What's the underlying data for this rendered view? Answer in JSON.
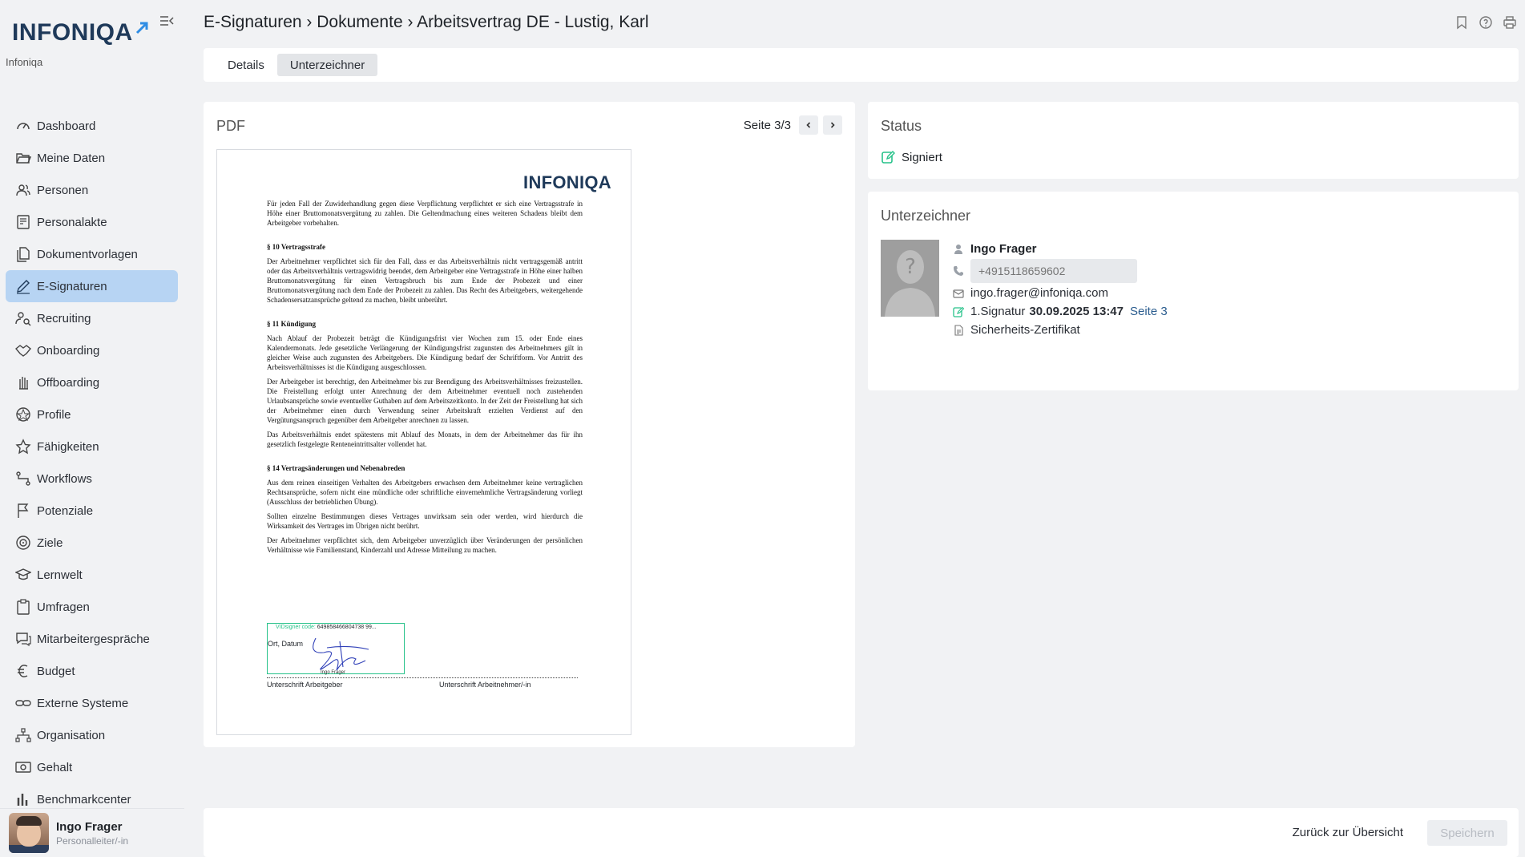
{
  "app": {
    "logo_text": "INFONIQA",
    "tenant": "Infoniqa"
  },
  "sidebar": {
    "items": [
      {
        "label": "Dashboard",
        "icon": "gauge-icon"
      },
      {
        "label": "Meine Daten",
        "icon": "folder-open-icon"
      },
      {
        "label": "Personen",
        "icon": "people-icon"
      },
      {
        "label": "Personalakte",
        "icon": "file-person-icon"
      },
      {
        "label": "Dokumentvorlagen",
        "icon": "documents-icon"
      },
      {
        "label": "E-Signaturen",
        "icon": "pen-icon",
        "active": true
      },
      {
        "label": "Recruiting",
        "icon": "person-search-icon"
      },
      {
        "label": "Onboarding",
        "icon": "handshake-icon"
      },
      {
        "label": "Offboarding",
        "icon": "hand-icon"
      },
      {
        "label": "Profile",
        "icon": "badge-icon"
      },
      {
        "label": "Fähigkeiten",
        "icon": "star-icon"
      },
      {
        "label": "Workflows",
        "icon": "workflow-icon"
      },
      {
        "label": "Potenziale",
        "icon": "flag-icon"
      },
      {
        "label": "Ziele",
        "icon": "target-icon"
      },
      {
        "label": "Lernwelt",
        "icon": "graduation-cap-icon"
      },
      {
        "label": "Umfragen",
        "icon": "clipboard-icon"
      },
      {
        "label": "Mitarbeitergespräche",
        "icon": "chat-icon"
      },
      {
        "label": "Budget",
        "icon": "euro-icon"
      },
      {
        "label": "Externe Systeme",
        "icon": "link-icon"
      },
      {
        "label": "Organisation",
        "icon": "org-chart-icon"
      },
      {
        "label": "Gehalt",
        "icon": "money-icon"
      },
      {
        "label": "Benchmarkcenter",
        "icon": "bar-chart-icon"
      }
    ],
    "user": {
      "name": "Ingo Frager",
      "role": "Personalleiter/-in"
    }
  },
  "header": {
    "breadcrumb": "E-Signaturen › Dokumente › Arbeitsvertrag DE - Lustig, Karl",
    "icons": [
      "bookmark-icon",
      "help-icon",
      "print-icon"
    ]
  },
  "tabs": [
    {
      "label": "Details",
      "active": false
    },
    {
      "label": "Unterzeichner",
      "active": true
    }
  ],
  "pdf": {
    "title": "PDF",
    "pager": "Seite 3/3",
    "page_logo": "INFONIQA",
    "intro": "Für jeden Fall der Zuwiderhandlung gegen diese Verpflichtung verpflichtet er sich eine Vertragsstrafe in Höhe einer Bruttomonatsvergütung zu zahlen. Die Geltendmachung eines weiteren Schadens bleibt dem Arbeitgeber vorbehalten.",
    "s10_title": "§ 10 Vertragsstrafe",
    "s10_text": "Der Arbeitnehmer verpflichtet sich für den Fall, dass er das Arbeitsverhältnis nicht vertragsgemäß antritt oder das Arbeitsverhältnis vertragswidrig beendet, dem Arbeitgeber eine Vertragsstrafe in Höhe einer halben Bruttomonatsvergütung für einen Vertragsbruch bis zum Ende der Probezeit und einer Bruttomonatsvergütung nach dem Ende der Probezeit zu zahlen. Das Recht des Arbeitgebers, weitergehende Schadensersatzansprüche geltend zu machen, bleibt unberührt.",
    "s11_title": "§ 11 Kündigung",
    "s11_p1": "Nach Ablauf der Probezeit beträgt die Kündigungsfrist vier Wochen zum 15. oder Ende eines Kalendermonats. Jede gesetzliche Verlängerung der Kündigungsfrist zugunsten des Arbeitnehmers gilt in gleicher Weise auch zugunsten des Arbeitgebers. Die Kündigung bedarf der Schriftform. Vor Antritt des Arbeitsverhältnisses ist die Kündigung ausgeschlossen.",
    "s11_p2": "Der Arbeitgeber ist berechtigt, den Arbeitnehmer bis zur Beendigung des Arbeitsverhältnisses freizustellen. Die Freistellung erfolgt unter Anrechnung der dem Arbeitnehmer eventuell noch zustehenden Urlaubsansprüche sowie eventueller Guthaben auf dem Arbeitszeitkonto. In der Zeit der Freistellung hat sich der Arbeitnehmer einen durch Verwendung seiner Arbeitskraft erzielten Verdienst auf den Vergütungsanspruch gegenüber dem Arbeitgeber anrechnen zu lassen.",
    "s11_p3": "Das Arbeitsverhältnis endet spätestens mit Ablauf des Monats, in dem der Arbeitnehmer das für ihn gesetzlich festgelegte Renteneintrittsalter vollendet hat.",
    "s14_title": "§ 14 Vertragsänderungen und Nebenabreden",
    "s14_p1": "Aus dem reinen einseitigen Verhalten des Arbeitgebers erwachsen dem Arbeitnehmer keine vertraglichen Rechtsansprüche, sofern nicht eine mündliche oder schriftliche einvernehmliche Vertragsänderung vorliegt (Ausschluss der betrieblichen Übung).",
    "s14_p2": "Sollten einzelne Bestimmungen dieses Vertrages unwirksam sein oder werden, wird hierdurch die Wirksamkeit des Vertrages im Übrigen nicht berührt.",
    "s14_p3": "Der Arbeitnehmer verpflichtet sich, dem Arbeitgeber unverzüglich über Veränderungen der persönlichen Verhältnisse wie Familienstand, Kinderzahl und Adresse Mitteilung zu machen.",
    "sig_code_label": "VIDsigner code:",
    "sig_code_value": "649858466804738 99...",
    "ort_datum": "Ort, Datum",
    "sig_small_name": "Ingo Frager",
    "sig_label_left": "Unterschrift Arbeitgeber",
    "sig_label_right": "Unterschrift Arbeitnehmer/-in"
  },
  "status": {
    "title": "Status",
    "value": "Signiert",
    "accent": "#27c28a"
  },
  "signer": {
    "title": "Unterzeichner",
    "name": "Ingo Frager",
    "phone_placeholder": "+4915118659602",
    "email": "ingo.frager@infoniqa.com",
    "sig_label": "1.Signatur",
    "sig_datetime": "30.09.2025 13:47",
    "sig_page": "Seite 3",
    "certificate": "Sicherheits-Zertifikat"
  },
  "footer": {
    "back_label": "Zurück zur Übersicht",
    "save_label": "Speichern"
  }
}
